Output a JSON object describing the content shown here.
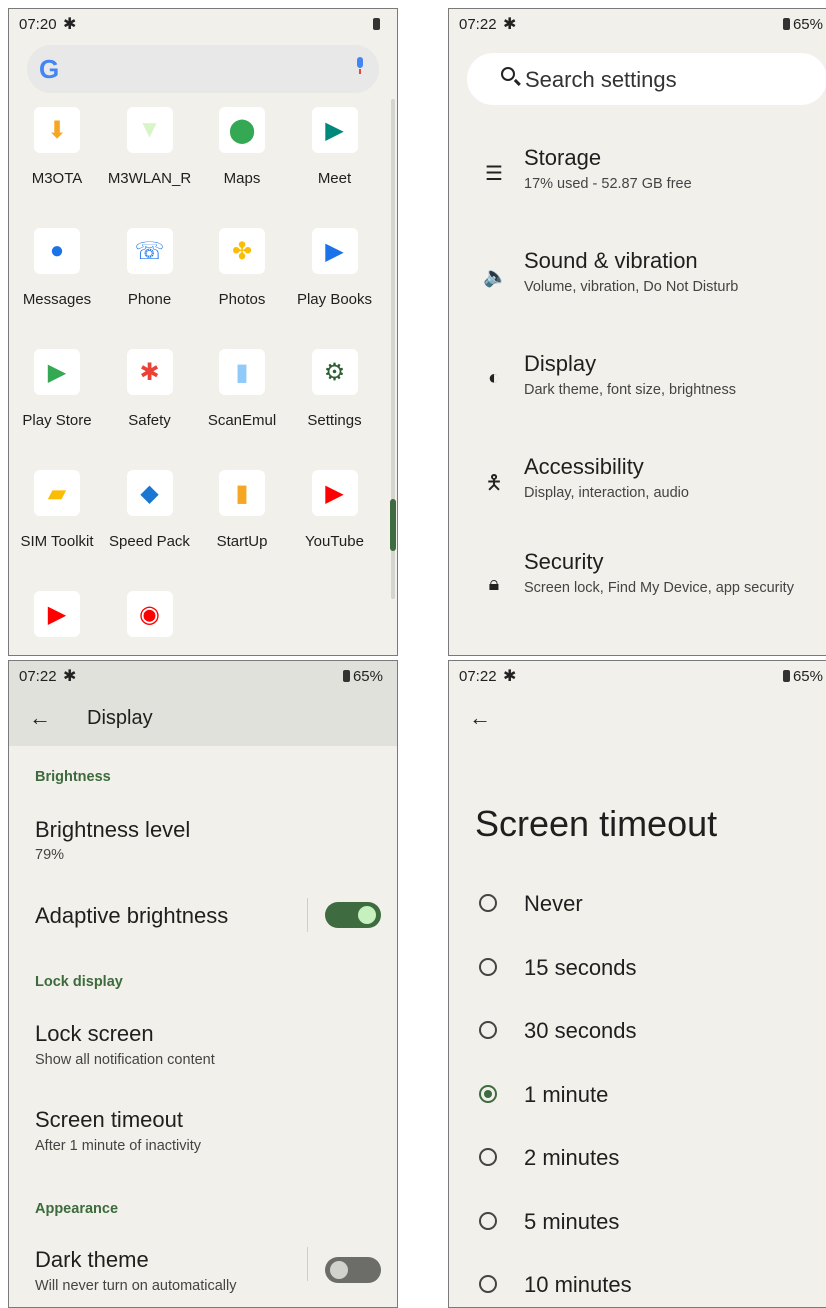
{
  "panel_drawer": {
    "status": {
      "time": "07:20"
    },
    "search": {
      "logo": "G"
    },
    "apps": [
      {
        "label": "M3OTA",
        "icon": "download-device-icon",
        "color": "#f5a623"
      },
      {
        "label": "M3WLAN_R",
        "icon": "wifi-info-icon",
        "color": "#d8f5c8"
      },
      {
        "label": "Maps",
        "icon": "maps-pin-icon",
        "color": "#34a853"
      },
      {
        "label": "Meet",
        "icon": "video-camera-icon",
        "color": "#00897b"
      },
      {
        "label": "Messages",
        "icon": "message-bubble-icon",
        "color": "#1a73e8"
      },
      {
        "label": "Phone",
        "icon": "phone-handset-icon",
        "color": "#1a73e8"
      },
      {
        "label": "Photos",
        "icon": "pinwheel-icon",
        "color": "#fbbc04"
      },
      {
        "label": "Play Books",
        "icon": "book-play-icon",
        "color": "#1a73e8"
      },
      {
        "label": "Play Store",
        "icon": "play-triangle-icon",
        "color": "#34a853"
      },
      {
        "label": "Safety",
        "icon": "safety-asterisk-icon",
        "color": "#ea4335"
      },
      {
        "label": "ScanEmul",
        "icon": "barcode-icon",
        "color": "#90caf9"
      },
      {
        "label": "Settings",
        "icon": "gear-icon",
        "color": "#2e5e34"
      },
      {
        "label": "SIM Toolkit",
        "icon": "sim-card-icon",
        "color": "#fbbc04"
      },
      {
        "label": "Speed Pack",
        "icon": "speed-box-icon",
        "color": "#1976d2"
      },
      {
        "label": "StartUp",
        "icon": "device-startup-icon",
        "color": "#f5a623"
      },
      {
        "label": "YouTube",
        "icon": "youtube-play-icon",
        "color": "#ff0000"
      },
      {
        "label": "",
        "icon": "youtube-kids-icon",
        "color": "#ff0000"
      },
      {
        "label": "",
        "icon": "youtube-music-icon",
        "color": "#ff0000"
      }
    ]
  },
  "panel_settings": {
    "status": {
      "time": "07:22",
      "battery": "65%"
    },
    "search_placeholder": "Search settings",
    "items": [
      {
        "title": "Storage",
        "sub": "17% used - 52.87 GB free",
        "icon": "storage-icon"
      },
      {
        "title": "Sound & vibration",
        "sub": "Volume, vibration, Do Not Disturb",
        "icon": "speaker-icon"
      },
      {
        "title": "Display",
        "sub": "Dark theme, font size, brightness",
        "icon": "brightness-icon"
      },
      {
        "title": "Accessibility",
        "sub": "Display, interaction, audio",
        "icon": "accessibility-icon"
      },
      {
        "title": "Security",
        "sub": "Screen lock, Find My Device, app security",
        "icon": "lock-icon"
      }
    ]
  },
  "panel_display": {
    "status": {
      "time": "07:22",
      "battery": "65%"
    },
    "title": "Display",
    "categories": {
      "brightness": "Brightness",
      "lock": "Lock display",
      "appearance": "Appearance"
    },
    "brightness_level": {
      "title": "Brightness level",
      "value": "79%"
    },
    "adaptive": {
      "title": "Adaptive brightness",
      "on": true
    },
    "lock_screen": {
      "title": "Lock screen",
      "sub": "Show all notification content"
    },
    "screen_timeout": {
      "title": "Screen timeout",
      "sub": "After 1 minute of inactivity"
    },
    "dark_theme": {
      "title": "Dark theme",
      "sub": "Will never turn on automatically",
      "on": false
    }
  },
  "panel_timeout": {
    "status": {
      "time": "07:22",
      "battery": "65%"
    },
    "title": "Screen timeout",
    "selected": "1 minute",
    "options": [
      "Never",
      "15 seconds",
      "30 seconds",
      "1 minute",
      "2 minutes",
      "5 minutes",
      "10 minutes"
    ]
  }
}
